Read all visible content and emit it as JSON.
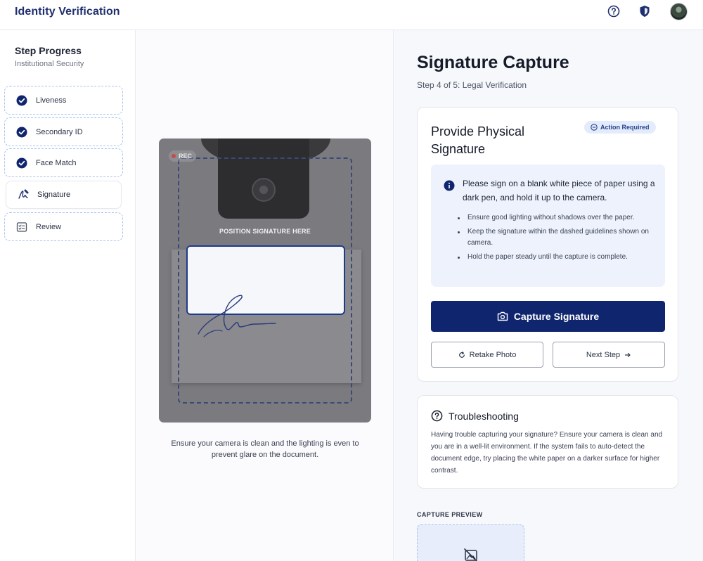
{
  "header": {
    "title": "Identity Verification",
    "icons": [
      "help-icon",
      "shield-icon"
    ]
  },
  "sidebar": {
    "title": "Step Progress",
    "subtitle": "Institutional Security",
    "steps": [
      {
        "label": "Liveness",
        "icon": "check-circle-icon",
        "status": "complete"
      },
      {
        "label": "Secondary ID",
        "icon": "check-circle-icon",
        "status": "complete"
      },
      {
        "label": "Face Match",
        "icon": "check-circle-icon",
        "status": "complete"
      },
      {
        "label": "Signature",
        "icon": "signature-icon",
        "status": "active"
      },
      {
        "label": "Review",
        "icon": "checklist-icon",
        "status": "pending"
      }
    ]
  },
  "camera": {
    "rec_label": "REC",
    "position_label": "POSITION SIGNATURE HERE",
    "caption": "Ensure your camera is clean and the lighting is even to prevent glare on the document."
  },
  "main": {
    "title": "Signature Capture",
    "subtitle": "Step 4 of 5: Legal Verification",
    "card": {
      "heading": "Provide Physical Signature",
      "badge": "Action Required",
      "instruction": "Please sign on a blank white piece of paper using a dark pen, and hold it up to the camera.",
      "tips": [
        "Ensure good lighting without shadows over the paper.",
        "Keep the signature within the dashed guidelines shown on camera.",
        "Hold the paper steady until the capture is complete."
      ],
      "capture_button": "Capture Signature",
      "retake_button": "Retake Photo",
      "next_button": "Next Step"
    },
    "troubleshooting": {
      "title": "Troubleshooting",
      "body": "Having trouble capturing your signature? Ensure your camera is clean and you are in a well-lit environment. If the system fails to auto-detect the document edge, try placing the white paper on a darker surface for higher contrast."
    },
    "preview": {
      "label": "CAPTURE PREVIEW"
    }
  },
  "colors": {
    "primary": "#0f256e",
    "brand_text": "#1e2f6f",
    "accent_light": "#edf2fc",
    "dashed_border": "#a9c4ef"
  }
}
